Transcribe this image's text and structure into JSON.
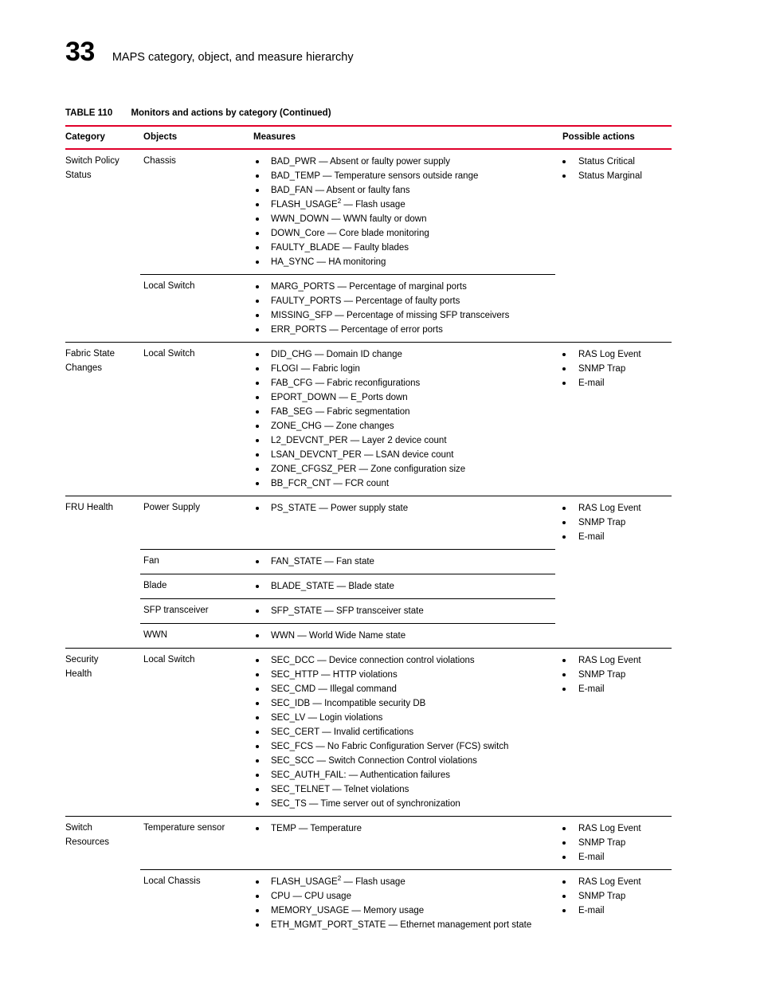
{
  "page": {
    "chapter_number": "33",
    "chapter_title": "MAPS category, object, and measure hierarchy"
  },
  "table": {
    "caption_label": "TABLE 110",
    "caption_text": "Monitors and actions by category (Continued)",
    "accent_color": "#e0002a",
    "columns": {
      "category": "Category",
      "objects": "Objects",
      "measures": "Measures",
      "actions": "Possible actions"
    },
    "sections": [
      {
        "category": "Switch Policy Status",
        "category_lines": [
          "Switch Policy",
          "Status"
        ],
        "actions": [
          "Status Critical",
          "Status Marginal"
        ],
        "subrows": [
          {
            "object": "Chassis",
            "measures": [
              "BAD_PWR — Absent or faulty power supply",
              "BAD_TEMP — Temperature sensors outside range",
              "BAD_FAN — Absent or faulty fans",
              "FLASH_USAGE|2| — Flash usage",
              "WWN_DOWN — WWN faulty or down",
              "DOWN_Core — Core blade monitoring",
              "FAULTY_BLADE — Faulty blades",
              "HA_SYNC — HA monitoring"
            ]
          },
          {
            "object": "Local Switch",
            "measures": [
              "MARG_PORTS — Percentage of marginal ports",
              "FAULTY_PORTS — Percentage of faulty ports",
              "MISSING_SFP — Percentage of missing SFP transceivers",
              "ERR_PORTS — Percentage of error ports"
            ]
          }
        ]
      },
      {
        "category": "Fabric State Changes",
        "category_lines": [
          "Fabric State",
          "Changes"
        ],
        "actions": [
          "RAS Log Event",
          "SNMP Trap",
          "E-mail"
        ],
        "subrows": [
          {
            "object": "Local Switch",
            "measures": [
              "DID_CHG — Domain ID change",
              "FLOGI — Fabric login",
              "FAB_CFG — Fabric reconfigurations",
              "EPORT_DOWN — E_Ports down",
              "FAB_SEG — Fabric segmentation",
              "ZONE_CHG — Zone changes",
              "L2_DEVCNT_PER — Layer 2 device count",
              "LSAN_DEVCNT_PER — LSAN device count",
              "ZONE_CFGSZ_PER — Zone configuration size",
              "BB_FCR_CNT — FCR count"
            ]
          }
        ]
      },
      {
        "category": "FRU Health",
        "category_lines": [
          "FRU Health"
        ],
        "actions": [
          "RAS Log Event",
          "SNMP Trap",
          "E-mail"
        ],
        "subrows": [
          {
            "object": "Power Supply",
            "measures": [
              "PS_STATE — Power supply state"
            ]
          },
          {
            "object": "Fan",
            "measures": [
              "FAN_STATE — Fan state"
            ]
          },
          {
            "object": "Blade",
            "measures": [
              "BLADE_STATE — Blade state"
            ]
          },
          {
            "object": "SFP transceiver",
            "measures": [
              "SFP_STATE — SFP transceiver state"
            ]
          },
          {
            "object": "WWN",
            "measures": [
              "WWN — World Wide Name state"
            ]
          }
        ]
      },
      {
        "category": "Security Health",
        "category_lines": [
          "Security",
          "Health"
        ],
        "actions": [
          "RAS Log Event",
          "SNMP Trap",
          "E-mail"
        ],
        "subrows": [
          {
            "object": "Local Switch",
            "measures": [
              "SEC_DCC — Device connection control violations",
              "SEC_HTTP — HTTP violations",
              "SEC_CMD — Illegal command",
              "SEC_IDB — Incompatible security DB",
              "SEC_LV — Login violations",
              "SEC_CERT — Invalid certifications",
              "SEC_FCS — No Fabric Configuration Server (FCS) switch",
              "SEC_SCC — Switch Connection Control violations",
              "SEC_AUTH_FAIL: — Authentication failures",
              "SEC_TELNET — Telnet violations",
              "SEC_TS — Time server out of synchronization"
            ]
          }
        ]
      },
      {
        "category": "Switch Resources",
        "category_lines": [
          "Switch",
          "Resources"
        ],
        "subrows": [
          {
            "object": "Temperature sensor",
            "measures": [
              "TEMP — Temperature"
            ],
            "actions": [
              "RAS Log Event",
              "SNMP Trap",
              "E-mail"
            ]
          },
          {
            "object": "Local Chassis",
            "measures": [
              "FLASH_USAGE|2| — Flash usage",
              "CPU — CPU usage",
              "MEMORY_USAGE — Memory usage",
              "ETH_MGMT_PORT_STATE — Ethernet management port state"
            ],
            "actions": [
              "RAS Log Event",
              "SNMP Trap",
              "E-mail"
            ]
          }
        ]
      }
    ]
  }
}
